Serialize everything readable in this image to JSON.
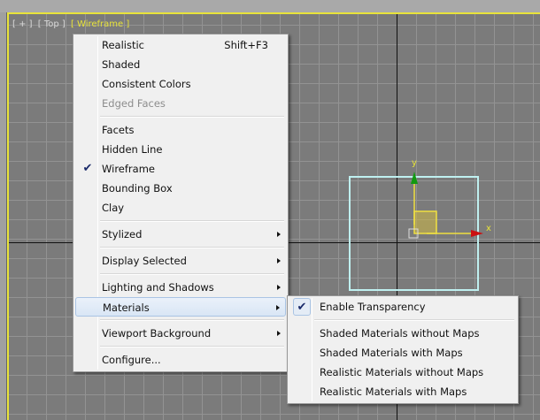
{
  "viewport": {
    "labels": [
      "[ + ]",
      "[ Top ]",
      "[ Wireframe ]"
    ],
    "active_label_index": 2,
    "border_color": "#e8e33a",
    "gizmo": {
      "x_label": "x",
      "y_label": "y",
      "x_color": "#cc1111",
      "y_color": "#119911",
      "selection_color": "#bff0f0"
    }
  },
  "menu": {
    "items": [
      {
        "label": "Realistic",
        "shortcut": "Shift+F3"
      },
      {
        "label": "Shaded"
      },
      {
        "label": "Consistent Colors"
      },
      {
        "label": "Edged Faces",
        "disabled": true
      },
      {
        "label": "Facets"
      },
      {
        "label": "Hidden Line"
      },
      {
        "label": "Wireframe",
        "checked": true
      },
      {
        "label": "Bounding Box"
      },
      {
        "label": "Clay"
      },
      {
        "label": "Stylized",
        "submenu": true
      },
      {
        "label": "Display Selected",
        "submenu": true
      },
      {
        "label": "Lighting and Shadows",
        "submenu": true
      },
      {
        "label": "Materials",
        "submenu": true,
        "highlighted": true
      },
      {
        "label": "Viewport Background",
        "submenu": true
      },
      {
        "label": "Configure..."
      }
    ]
  },
  "submenu": {
    "items": [
      {
        "label": "Enable Transparency",
        "checked": true
      },
      {
        "label": "Shaded Materials without Maps"
      },
      {
        "label": "Shaded Materials with Maps"
      },
      {
        "label": "Realistic Materials without Maps"
      },
      {
        "label": "Realistic Materials with Maps"
      }
    ]
  }
}
